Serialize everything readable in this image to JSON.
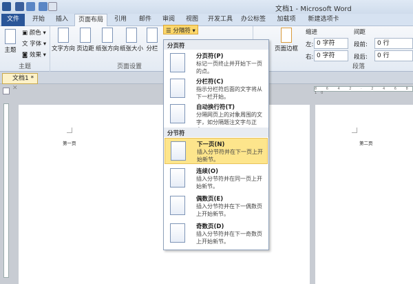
{
  "window": {
    "title": "文档1 - Microsoft Word"
  },
  "tabs": [
    {
      "label": "文件"
    },
    {
      "label": "开始"
    },
    {
      "label": "插入"
    },
    {
      "label": "页面布局"
    },
    {
      "label": "引用"
    },
    {
      "label": "邮件"
    },
    {
      "label": "审阅"
    },
    {
      "label": "视图"
    },
    {
      "label": "开发工具"
    },
    {
      "label": "办公标签"
    },
    {
      "label": "加载项"
    },
    {
      "label": "新建选项卡"
    }
  ],
  "ribbon": {
    "theme": {
      "label": "主题",
      "main": "主题",
      "colors": "颜色",
      "fonts": "字体",
      "effects": "效果"
    },
    "page_setup": {
      "label": "页面设置",
      "text_dir": "文字方向",
      "margins": "页边距",
      "orientation": "纸张方向",
      "size": "纸张大小",
      "columns": "分栏",
      "breaks": "分隔符"
    },
    "page_border": "页面边框",
    "paragraph": {
      "label": "段落",
      "indent": "缩进",
      "spacing": "间距",
      "left": "左:",
      "right": "右:",
      "before": "段前:",
      "after": "段后:",
      "left_val": "0 字符",
      "right_val": "0 字符",
      "before_val": "0 行",
      "after_val": "0 行"
    }
  },
  "doc_tab": {
    "label": "文档1 *"
  },
  "ruler": {
    "ticks": "8 6 4 2 · 2 4 6 8 10"
  },
  "pages": [
    {
      "text": "第一页"
    },
    {
      "text": "第二页"
    }
  ],
  "menu": {
    "page_breaks_header": "分页符",
    "section_breaks_header": "分节符",
    "items": [
      {
        "title": "分页符(P)",
        "desc": "标记一页终止并开始下一页的点。"
      },
      {
        "title": "分栏符(C)",
        "desc": "指示分栏符后面的文字将从下一栏开始。"
      },
      {
        "title": "自动换行符(T)",
        "desc": "分隔网页上的对象周围的文字，如分隔题注文字与正文。"
      },
      {
        "title": "下一页(N)",
        "desc": "插入分节符并在下一页上开始新节。"
      },
      {
        "title": "连续(O)",
        "desc": "插入分节符并在同一页上开始新节。"
      },
      {
        "title": "偶数页(E)",
        "desc": "插入分节符并在下一偶数页上开始新节。"
      },
      {
        "title": "奇数页(D)",
        "desc": "插入分节符并在下一奇数页上开始新节。"
      }
    ]
  },
  "colors": {
    "accent": "#2a5699",
    "highlight": "#fde58c"
  }
}
